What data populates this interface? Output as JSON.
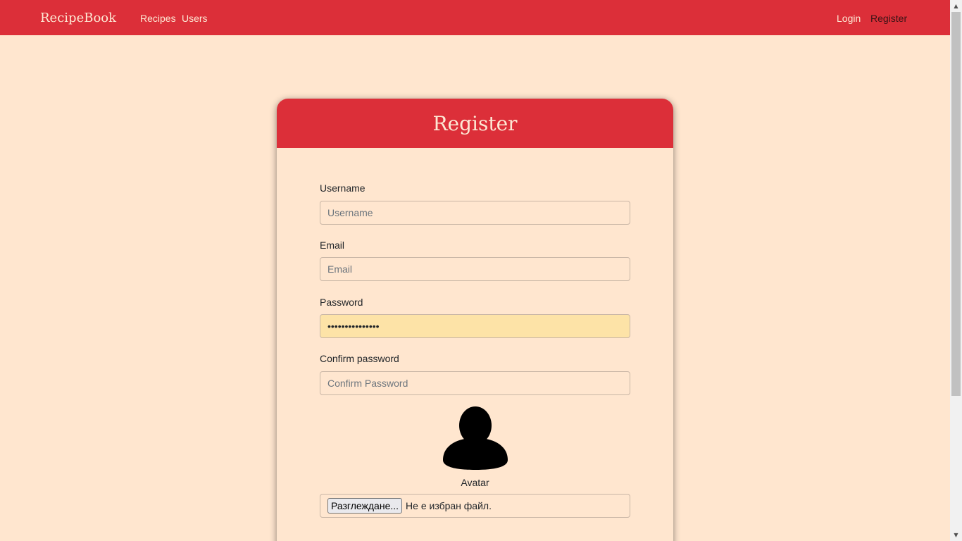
{
  "navbar": {
    "brand": "RecipeBook",
    "links": [
      {
        "label": "Recipes"
      },
      {
        "label": "Users"
      }
    ],
    "auth": [
      {
        "label": "Login"
      },
      {
        "label": "Register"
      }
    ],
    "color": "#dc2f39"
  },
  "form": {
    "title": "Register",
    "fields": [
      {
        "label": "Username",
        "placeholder": "Username",
        "value": ""
      },
      {
        "label": "Email",
        "placeholder": "Email",
        "value": ""
      },
      {
        "label": "Password",
        "placeholder": "Password",
        "value": "•••••••••••••••"
      },
      {
        "label": "Confirm password",
        "placeholder": "Confirm Password",
        "value": ""
      }
    ],
    "avatar": {
      "icon": "user-silhouette-icon",
      "label": "Avatar",
      "button_label": "Разглеждане...",
      "status": "Не е избран файл."
    }
  },
  "colors": {
    "background": "#ffe6cf",
    "accent": "#dc2f39",
    "autofill": "#fde3a7"
  }
}
